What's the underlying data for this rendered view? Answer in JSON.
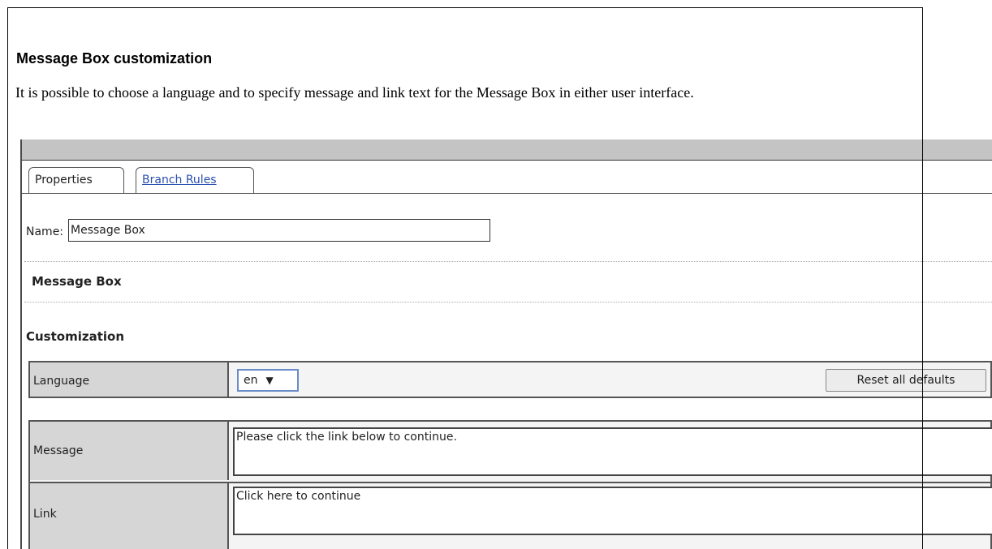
{
  "doc": {
    "heading": "Message Box customization",
    "intro": "It is possible to choose a language and to specify message and link text for the Message Box in either user interface."
  },
  "ui": {
    "tabs": [
      {
        "label": "Properties",
        "active": true
      },
      {
        "label": "Branch Rules",
        "active": false
      }
    ],
    "name_label": "Name:",
    "name_value": "Message Box",
    "section_title": "Message Box",
    "customization_title": "Customization",
    "language_label": "Language",
    "language_value": "en",
    "reset_button": "Reset all defaults",
    "message_label": "Message",
    "message_value": "Please click the link below to continue.",
    "link_label": "Link",
    "link_value": "Click here to continue"
  }
}
